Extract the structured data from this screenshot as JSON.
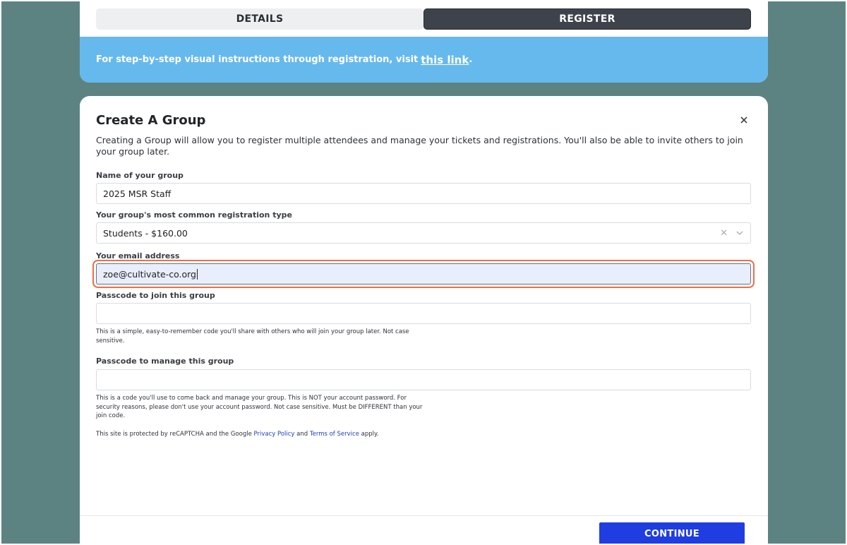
{
  "tabs": {
    "details": "DETAILS",
    "register": "REGISTER"
  },
  "banner": {
    "text": "For step-by-step visual instructions through registration, visit",
    "link": "this link",
    "suffix": "."
  },
  "modal": {
    "title": "Create A Group",
    "intro": "Creating a Group will allow you to register multiple attendees and manage your tickets and registrations. You'll also be able to invite others to join your group later.",
    "fields": {
      "group_name": {
        "label": "Name of your group",
        "value": "2025 MSR Staff"
      },
      "reg_type": {
        "label": "Your group's most common registration type",
        "value": "Students - $160.00"
      },
      "email": {
        "label": "Your email address",
        "value": "zoe@cultivate-co.org"
      },
      "join_code": {
        "label": "Passcode to join this group",
        "value": "",
        "help": "This is a simple, easy-to-remember code you'll share with others who will join your group later. Not case sensitive."
      },
      "manage_code": {
        "label": "Passcode to manage this group",
        "value": "",
        "help": "This is a code you'll use to come back and manage your group. This is NOT your account password. For security reasons, please don't use your account password. Not case sensitive. Must be DIFFERENT than your join code."
      }
    },
    "recaptcha": {
      "prefix": "This site is protected by reCAPTCHA and the Google",
      "privacy": "Privacy Policy",
      "and": "and",
      "terms": "Terms of Service",
      "suffix": "apply."
    },
    "continue_label": "CONTINUE"
  },
  "colors": {
    "background": "#5c8381",
    "banner": "#66b9ec",
    "tab_active": "#3e434b",
    "focus_ring": "#ec6f4a",
    "primary_button": "#1f3de0",
    "link": "#1f3fbf"
  },
  "icons": {
    "close": "close-icon",
    "clear": "clear-icon",
    "chevron": "chevron-down-icon"
  }
}
